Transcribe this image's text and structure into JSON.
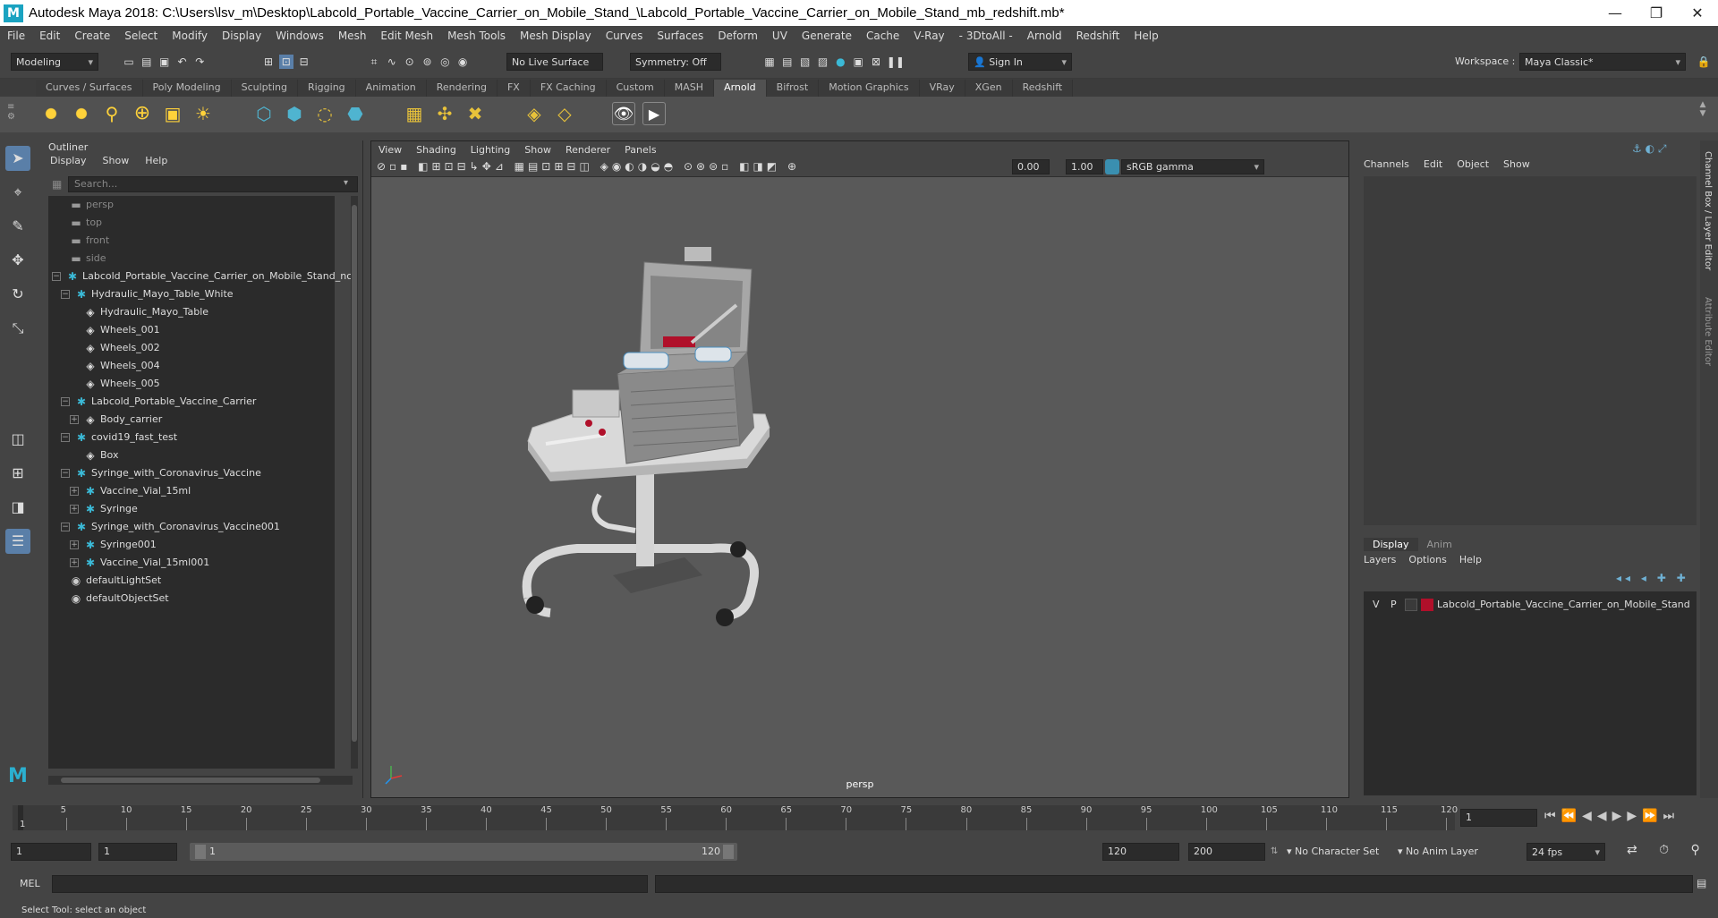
{
  "window": {
    "title": "Autodesk Maya 2018: C:\\Users\\lsv_m\\Desktop\\Labcold_Portable_Vaccine_Carrier_on_Mobile_Stand_\\Labcold_Portable_Vaccine_Carrier_on_Mobile_Stand_mb_redshift.mb*",
    "logo": "M",
    "minimize": "—",
    "restore": "❐",
    "close": "✕"
  },
  "menubar": [
    "File",
    "Edit",
    "Create",
    "Select",
    "Modify",
    "Display",
    "Windows",
    "Mesh",
    "Edit Mesh",
    "Mesh Tools",
    "Mesh Display",
    "Curves",
    "Surfaces",
    "Deform",
    "UV",
    "Generate",
    "Cache",
    "V-Ray",
    "- 3DtoAll -",
    "Arnold",
    "Redshift",
    "Help"
  ],
  "statusline": {
    "mode": "Modeling",
    "live_surface": "No Live Surface",
    "symmetry": "Symmetry: Off",
    "sign_in": "Sign In",
    "workspace_label": "Workspace :",
    "workspace": "Maya Classic*"
  },
  "shelf_tabs": [
    "Curves / Surfaces",
    "Poly Modeling",
    "Sculpting",
    "Rigging",
    "Animation",
    "Rendering",
    "FX",
    "FX Caching",
    "Custom",
    "MASH",
    "Arnold",
    "Bifrost",
    "Motion Graphics",
    "VRay",
    "XGen",
    "Redshift"
  ],
  "shelf_active": "Arnold",
  "outliner": {
    "title": "Outliner",
    "menu": [
      "Display",
      "Show",
      "Help"
    ],
    "search_placeholder": "Search...",
    "items": [
      {
        "label": "persp",
        "icon": "camera-icon",
        "indent": 0,
        "exp": "",
        "dim": true
      },
      {
        "label": "top",
        "icon": "camera-icon",
        "indent": 0,
        "exp": "",
        "dim": true
      },
      {
        "label": "front",
        "icon": "camera-icon",
        "indent": 0,
        "exp": "",
        "dim": true
      },
      {
        "label": "side",
        "icon": "camera-icon",
        "indent": 0,
        "exp": "",
        "dim": true
      },
      {
        "label": "Labcold_Portable_Vaccine_Carrier_on_Mobile_Stand_ncl",
        "icon": "group-icon",
        "indent": 0,
        "exp": "−",
        "dim": false
      },
      {
        "label": "Hydraulic_Mayo_Table_White",
        "icon": "group-icon",
        "indent": 1,
        "exp": "−",
        "dim": false
      },
      {
        "label": "Hydraulic_Mayo_Table",
        "icon": "mesh-icon",
        "indent": 2,
        "exp": "",
        "dim": false
      },
      {
        "label": "Wheels_001",
        "icon": "mesh-icon",
        "indent": 2,
        "exp": "",
        "dim": false
      },
      {
        "label": "Wheels_002",
        "icon": "mesh-icon",
        "indent": 2,
        "exp": "",
        "dim": false
      },
      {
        "label": "Wheels_004",
        "icon": "mesh-icon",
        "indent": 2,
        "exp": "",
        "dim": false
      },
      {
        "label": "Wheels_005",
        "icon": "mesh-icon",
        "indent": 2,
        "exp": "",
        "dim": false
      },
      {
        "label": "Labcold_Portable_Vaccine_Carrier",
        "icon": "group-icon",
        "indent": 1,
        "exp": "−",
        "dim": false
      },
      {
        "label": "Body_carrier",
        "icon": "mesh-icon",
        "indent": 2,
        "exp": "+",
        "dim": false
      },
      {
        "label": "covid19_fast_test",
        "icon": "group-icon",
        "indent": 1,
        "exp": "−",
        "dim": false
      },
      {
        "label": "Box",
        "icon": "mesh-icon",
        "indent": 2,
        "exp": "",
        "dim": false
      },
      {
        "label": "Syringe_with_Coronavirus_Vaccine",
        "icon": "group-icon",
        "indent": 1,
        "exp": "−",
        "dim": false
      },
      {
        "label": "Vaccine_Vial_15ml",
        "icon": "group-icon",
        "indent": 2,
        "exp": "+",
        "dim": false
      },
      {
        "label": "Syringe",
        "icon": "group-icon",
        "indent": 2,
        "exp": "+",
        "dim": false
      },
      {
        "label": "Syringe_with_Coronavirus_Vaccine001",
        "icon": "group-icon",
        "indent": 1,
        "exp": "−",
        "dim": false
      },
      {
        "label": "Syringe001",
        "icon": "group-icon",
        "indent": 2,
        "exp": "+",
        "dim": false
      },
      {
        "label": "Vaccine_Vial_15ml001",
        "icon": "group-icon",
        "indent": 2,
        "exp": "+",
        "dim": false
      },
      {
        "label": "defaultLightSet",
        "icon": "set-icon",
        "indent": 0,
        "exp": "",
        "dim": false
      },
      {
        "label": "defaultObjectSet",
        "icon": "set-icon",
        "indent": 0,
        "exp": "",
        "dim": false
      }
    ]
  },
  "viewport": {
    "menu": [
      "View",
      "Shading",
      "Lighting",
      "Show",
      "Renderer",
      "Panels"
    ],
    "exposure": "0.00",
    "gamma": "1.00",
    "color_space": "sRGB gamma",
    "camera_label": "persp"
  },
  "channelbox": {
    "menu": [
      "Channels",
      "Edit",
      "Object",
      "Show"
    ],
    "side_tabs": [
      "Channel Box / Layer Editor",
      "Attribute Editor"
    ],
    "layer_tabs": [
      "Display",
      "Anim"
    ],
    "layer_menu": [
      "Layers",
      "Options",
      "Help"
    ],
    "layer": {
      "v": "V",
      "p": "P",
      "name": "Labcold_Portable_Vaccine_Carrier_on_Mobile_Stand",
      "color": "#b0102a"
    }
  },
  "timeline": {
    "ticks": [
      "5",
      "10",
      "15",
      "20",
      "25",
      "30",
      "35",
      "40",
      "45",
      "50",
      "55",
      "60",
      "65",
      "70",
      "75",
      "80",
      "85",
      "90",
      "95",
      "100",
      "105",
      "110",
      "115",
      "120"
    ],
    "start_tick": "1",
    "current_frame": "1"
  },
  "range": {
    "start": "1",
    "anim_start": "1",
    "slider_start": "1",
    "slider_end": "120",
    "end": "120",
    "anim_end": "200",
    "character_set": "No Character Set",
    "anim_layer": "No Anim Layer",
    "fps": "24 fps"
  },
  "cmdline": {
    "label": "MEL"
  },
  "helpline": {
    "text": "Select Tool: select an object"
  }
}
